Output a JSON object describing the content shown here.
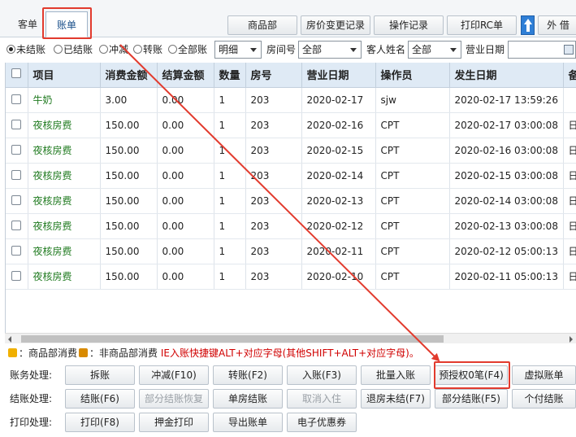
{
  "tabs": [
    {
      "label": "客单"
    },
    {
      "label": "账单"
    }
  ],
  "toolbar": {
    "buttons": [
      "商品部",
      "房价变更记录",
      "操作记录",
      "打印RC单",
      "外 借"
    ]
  },
  "filters": {
    "radios": [
      {
        "label": "未结账",
        "checked": true
      },
      {
        "label": "已结账",
        "checked": false
      },
      {
        "label": "冲减",
        "checked": false
      },
      {
        "label": "转账",
        "checked": false
      },
      {
        "label": "全部账",
        "checked": false
      }
    ],
    "detail_select": "明细",
    "room_label": "房间号",
    "room_select": "全部",
    "guest_label": "客人姓名",
    "guest_select": "全部",
    "biz_date_label": "营业日期"
  },
  "table": {
    "headers": [
      "项目",
      "消费金额",
      "结算金额",
      "数量",
      "房号",
      "营业日期",
      "操作员",
      "发生日期",
      "备"
    ],
    "rows": [
      [
        "牛奶",
        "3.00",
        "0.00",
        "1",
        "203",
        "2020-02-17",
        "sjw",
        "2020-02-17 13:59:26",
        ""
      ],
      [
        "夜核房费",
        "150.00",
        "0.00",
        "1",
        "203",
        "2020-02-16",
        "CPT",
        "2020-02-17 03:00:08",
        "日"
      ],
      [
        "夜核房费",
        "150.00",
        "0.00",
        "1",
        "203",
        "2020-02-15",
        "CPT",
        "2020-02-16 03:00:08",
        "日"
      ],
      [
        "夜核房费",
        "150.00",
        "0.00",
        "1",
        "203",
        "2020-02-14",
        "CPT",
        "2020-02-15 03:00:08",
        "日"
      ],
      [
        "夜核房费",
        "150.00",
        "0.00",
        "1",
        "203",
        "2020-02-13",
        "CPT",
        "2020-02-14 03:00:08",
        "日"
      ],
      [
        "夜核房费",
        "150.00",
        "0.00",
        "1",
        "203",
        "2020-02-12",
        "CPT",
        "2020-02-13 03:00:08",
        "日"
      ],
      [
        "夜核房费",
        "150.00",
        "0.00",
        "1",
        "203",
        "2020-02-11",
        "CPT",
        "2020-02-12 05:00:13",
        "日"
      ],
      [
        "夜核房费",
        "150.00",
        "0.00",
        "1",
        "203",
        "2020-02-10",
        "CPT",
        "2020-02-11 05:00:13",
        "日"
      ]
    ]
  },
  "legend": {
    "part1": "：商品部消费",
    "part2": "：非商品部消费",
    "hint": "IE入账快捷键ALT+对应字母(其他SHIFT+ALT+对应字母)。"
  },
  "actions": {
    "row1_label": "账务处理:",
    "row1": [
      "拆账",
      "冲减(F10)",
      "转账(F2)",
      "入账(F3)",
      "批量入账",
      "预授权0笔(F4)",
      "虚拟账单"
    ],
    "row2_label": "结账处理:",
    "row2": [
      "结账(F6)",
      "部分结账恢复",
      "单房结账",
      "取消入住",
      "退房未结(F7)",
      "部分结账(F5)",
      "个付结账"
    ],
    "row3_label": "打印处理:",
    "row3": [
      "打印(F8)",
      "押金打印",
      "导出账单",
      "电子优惠券"
    ]
  },
  "colors": {
    "annotation": "#e23b2e",
    "header_bg": "#dfeaf5",
    "item_text": "#1f7a1f",
    "hint_text": "#d00000"
  }
}
